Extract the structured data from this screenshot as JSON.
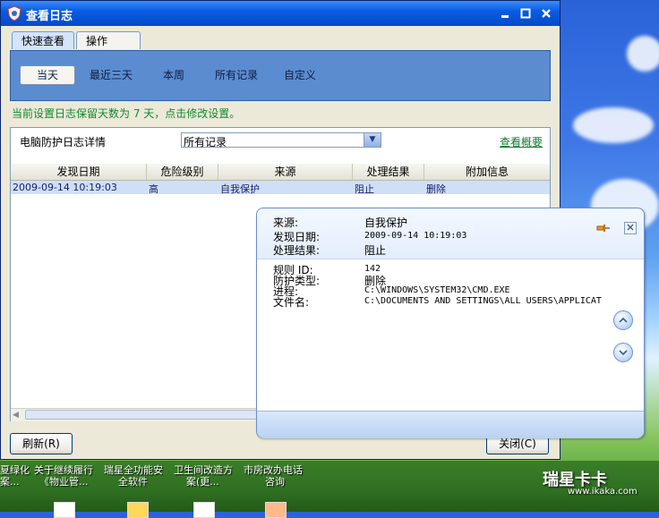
{
  "window": {
    "title": "查看日志"
  },
  "tabs": [
    "快速查看",
    "操作"
  ],
  "filters": [
    "当天",
    "最近三天",
    "本周",
    "所有记录",
    "自定义"
  ],
  "hint": "当前设置日志保留天数为 7 天，点击修改设置。",
  "panel": {
    "label": "电脑防护日志详情",
    "select_value": "所有记录",
    "overview_link": "查看概要"
  },
  "table": {
    "headers": [
      "发现日期",
      "危险级别",
      "来源",
      "处理结果",
      "附加信息"
    ],
    "rows": [
      [
        "2009-09-14 10:19:03",
        "高",
        "自我保护",
        "阻止",
        "删除"
      ]
    ]
  },
  "buttons": {
    "refresh": "刷新(R)",
    "close": "关闭(C)"
  },
  "popup": {
    "source_label": "来源:",
    "source_value": "自我保护",
    "date_label": "发现日期:",
    "date_value": "2009-09-14 10:19:03",
    "result_label": "处理结果:",
    "result_value": "阻止",
    "rule_id_label": "规则 ID:",
    "rule_id_value": "142",
    "protect_type_label": "防护类型:",
    "protect_type_value": "删除",
    "process_label": "进程:",
    "process_value": "C:\\WINDOWS\\SYSTEM32\\CMD.EXE",
    "file_label": "文件名:",
    "file_value": "C:\\DOCUMENTS AND SETTINGS\\ALL USERS\\APPLICAT"
  },
  "desktop_items": [
    {
      "line1": "夏绿化",
      "line2": "案..."
    },
    {
      "line1": "关于继续履行",
      "line2": "《物业管..."
    },
    {
      "line1": "瑞星全功能安",
      "line2": "全软件"
    },
    {
      "line1": "卫生间改造方",
      "line2": "案(更..."
    },
    {
      "line1": "市房改办电话",
      "line2": "咨询"
    }
  ],
  "watermark": {
    "brand": "瑞星卡卡",
    "url": "www.ikaka.com"
  },
  "colors": {
    "titlebar": "#0553d6",
    "tabpanel": "#5b8ccf",
    "hint": "#0f8a2e",
    "selected_row": "#cfe0f6"
  }
}
